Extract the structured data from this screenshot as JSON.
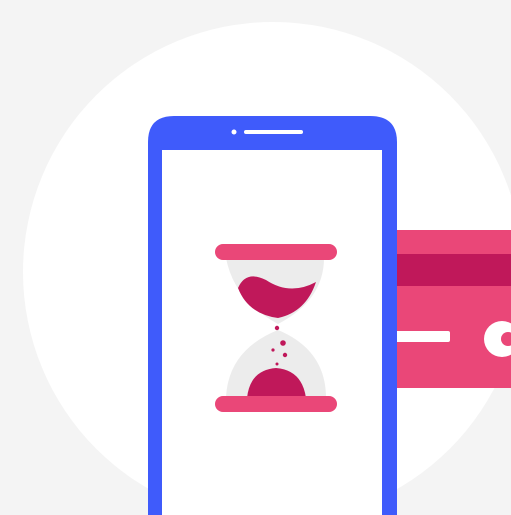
{
  "illustration": {
    "subject": "payment-pending-hourglass",
    "colors": {
      "page_background": "#f4f4f4",
      "circle_background": "#ffffff",
      "phone_frame": "#3f5bfb",
      "phone_screen": "#ffffff",
      "card_body": "#ea4778",
      "card_stripe": "#c0185a",
      "card_marks": "#ffffff",
      "hourglass_caps": "#ea4778",
      "hourglass_glass": "#ececec",
      "hourglass_sand": "#c0185a"
    },
    "icons": [
      "smartphone-icon",
      "credit-card-icon",
      "hourglass-icon"
    ]
  }
}
